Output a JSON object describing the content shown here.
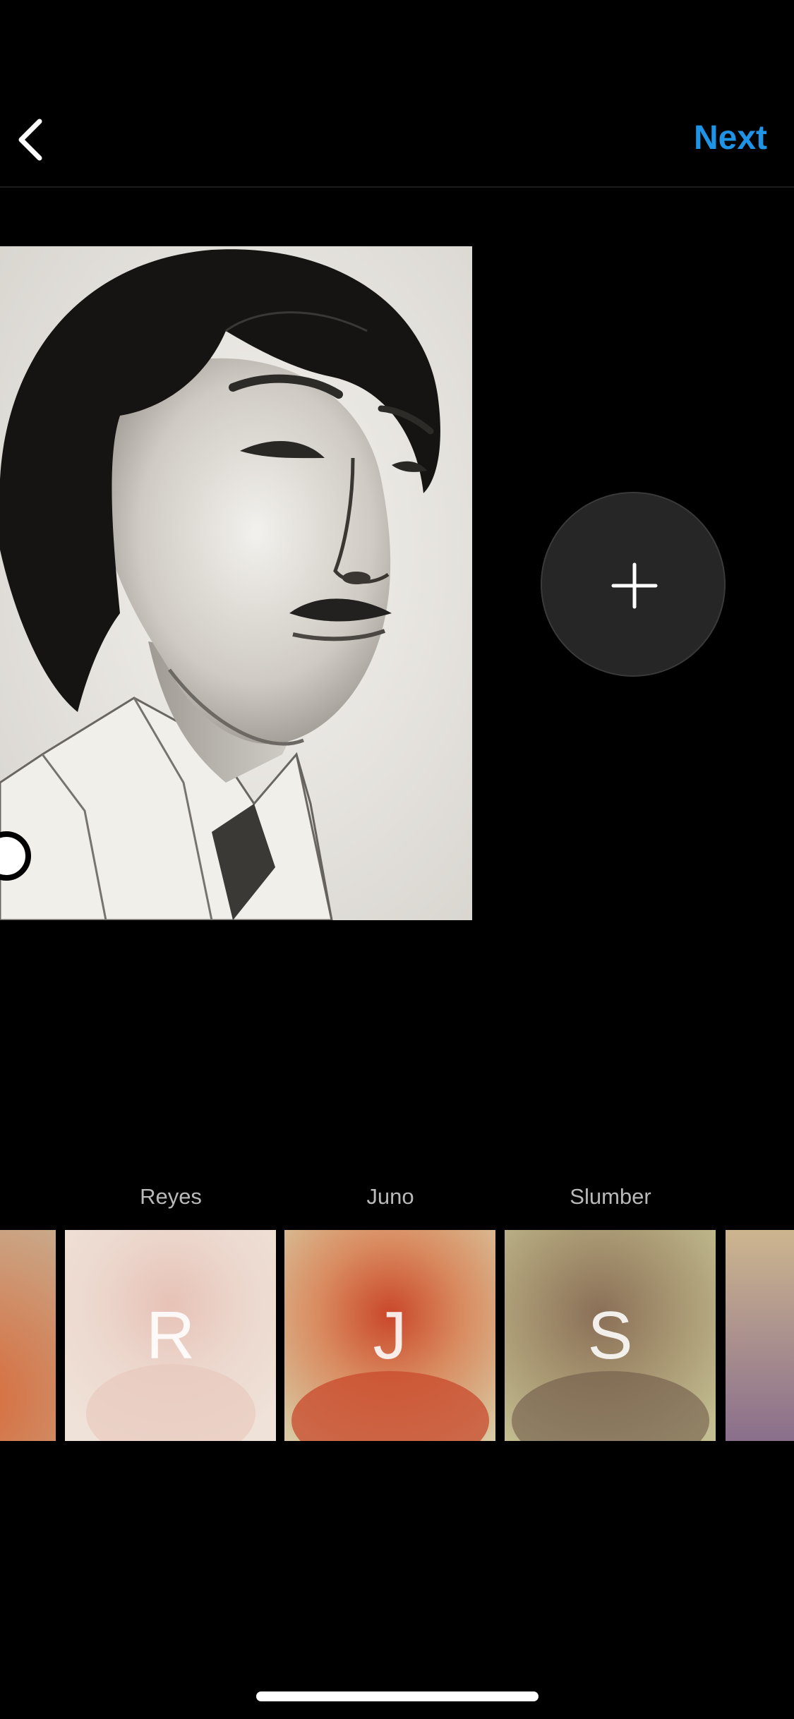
{
  "header": {
    "back_icon": "chevron-left-icon",
    "next_label": "Next",
    "accent_color": "#1f93e6"
  },
  "canvas": {
    "add_icon": "plus-icon"
  },
  "filters": [
    {
      "label": "",
      "letter": ""
    },
    {
      "label": "Reyes",
      "letter": "R"
    },
    {
      "label": "Juno",
      "letter": "J"
    },
    {
      "label": "Slumber",
      "letter": "S"
    },
    {
      "label": "",
      "letter": ""
    }
  ]
}
